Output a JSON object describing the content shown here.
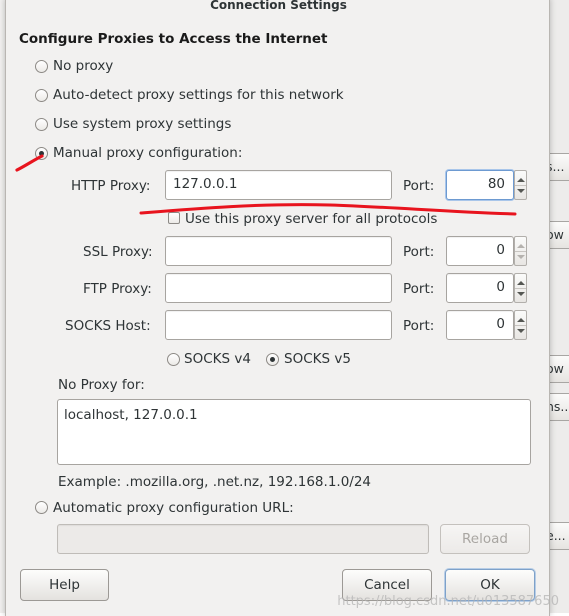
{
  "dialog": {
    "title": "Connection Settings",
    "section_title": "Configure Proxies to Access the Internet"
  },
  "proxy_options": {
    "no_proxy": "No proxy",
    "auto_detect": "Auto-detect proxy settings for this network",
    "system": "Use system proxy settings",
    "manual": "Manual proxy configuration:",
    "selected": "manual"
  },
  "http": {
    "label": "HTTP Proxy:",
    "value": "127.0.0.1",
    "port_label": "Port:",
    "port": "80",
    "use_for_all_label": "Use this proxy server for all protocols"
  },
  "ssl": {
    "label": "SSL Proxy:",
    "value": "",
    "port_label": "Port:",
    "port": "0"
  },
  "ftp": {
    "label": "FTP Proxy:",
    "value": "",
    "port_label": "Port:",
    "port": "0"
  },
  "socks": {
    "label": "SOCKS Host:",
    "value": "",
    "port_label": "Port:",
    "port": "0",
    "v4_label": "SOCKS v4",
    "v5_label": "SOCKS v5",
    "selected_version": "v5"
  },
  "no_proxy_for": {
    "label": "No Proxy for:",
    "value": "localhost, 127.0.0.1",
    "example": "Example: .mozilla.org, .net.nz, 192.168.1.0/24"
  },
  "auto_config": {
    "label": "Automatic proxy configuration URL:",
    "url": "",
    "reload_label": "Reload"
  },
  "buttons": {
    "help": "Help",
    "cancel": "Cancel",
    "ok": "OK"
  },
  "background_window": {
    "button_fragments": [
      "s...",
      "ow",
      "ow",
      "ns...",
      "e..."
    ]
  },
  "watermark": "https://blog.csdn.net/u013587650",
  "annotation_color": "#e8141e"
}
